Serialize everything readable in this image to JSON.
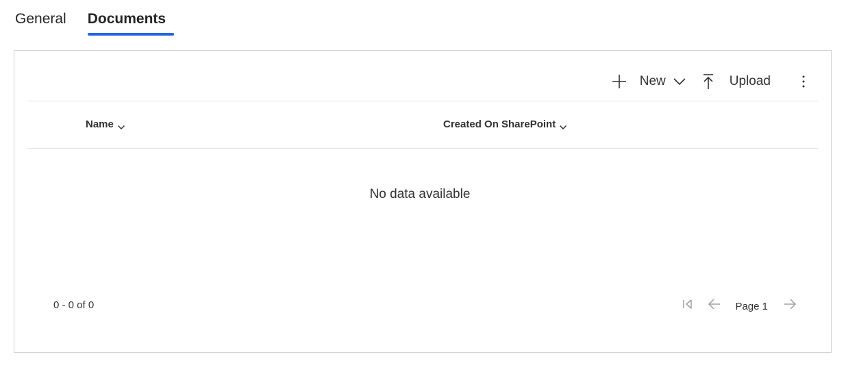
{
  "tabs": {
    "general_label": "General",
    "documents_label": "Documents",
    "active": "Documents"
  },
  "toolbar": {
    "new_label": "New",
    "upload_label": "Upload",
    "more_icon": "more-vertical-icon"
  },
  "grid": {
    "columns": [
      {
        "label": "Name",
        "sortable": true
      },
      {
        "label": "Created On SharePoint",
        "sortable": true
      }
    ],
    "rows": [],
    "empty_message": "No data available"
  },
  "footer": {
    "record_count": "0 - 0 of 0",
    "page_label": "Page 1"
  },
  "colors": {
    "accent": "#2266e3",
    "border": "#d1d1d1",
    "divider": "#e1dfdd",
    "text": "#323130",
    "disabled_icon": "#a19f9d"
  }
}
